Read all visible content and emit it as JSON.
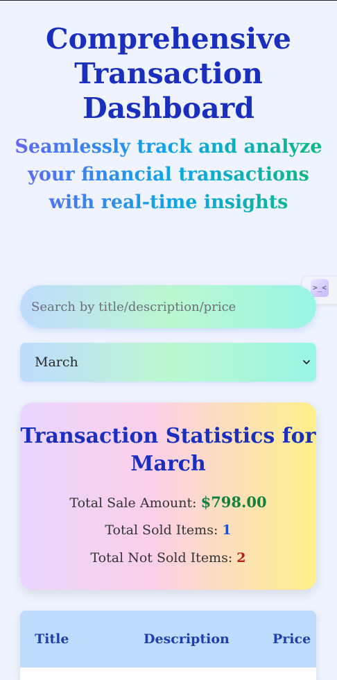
{
  "header": {
    "title": "Comprehensive Transaction Dashboard",
    "subtitle": "Seamlessly track and analyze your financial transactions with real-time insights"
  },
  "side_tab": {
    "icon": "terminal-face-icon",
    "glyph": ">_<"
  },
  "search": {
    "value": "",
    "placeholder": "Search by title/description/price"
  },
  "month_filter": {
    "selected": "March",
    "icon": "chevron-down-icon"
  },
  "stats": {
    "title": "Transaction Statistics for March",
    "total_sale_label": "Total Sale Amount:",
    "total_sale_value": "$798.00",
    "sold_label": "Total Sold Items:",
    "sold_value": "1",
    "not_sold_label": "Total Not Sold Items:",
    "not_sold_value": "2"
  },
  "table": {
    "columns": [
      "Title",
      "Description",
      "Price"
    ]
  },
  "colors": {
    "title": "#1b2fbf",
    "sale_value": "#15803d",
    "sold_value": "#1d4ed8",
    "not_sold_value": "#b91c1c",
    "table_header_bg": "#bfdbfe"
  }
}
